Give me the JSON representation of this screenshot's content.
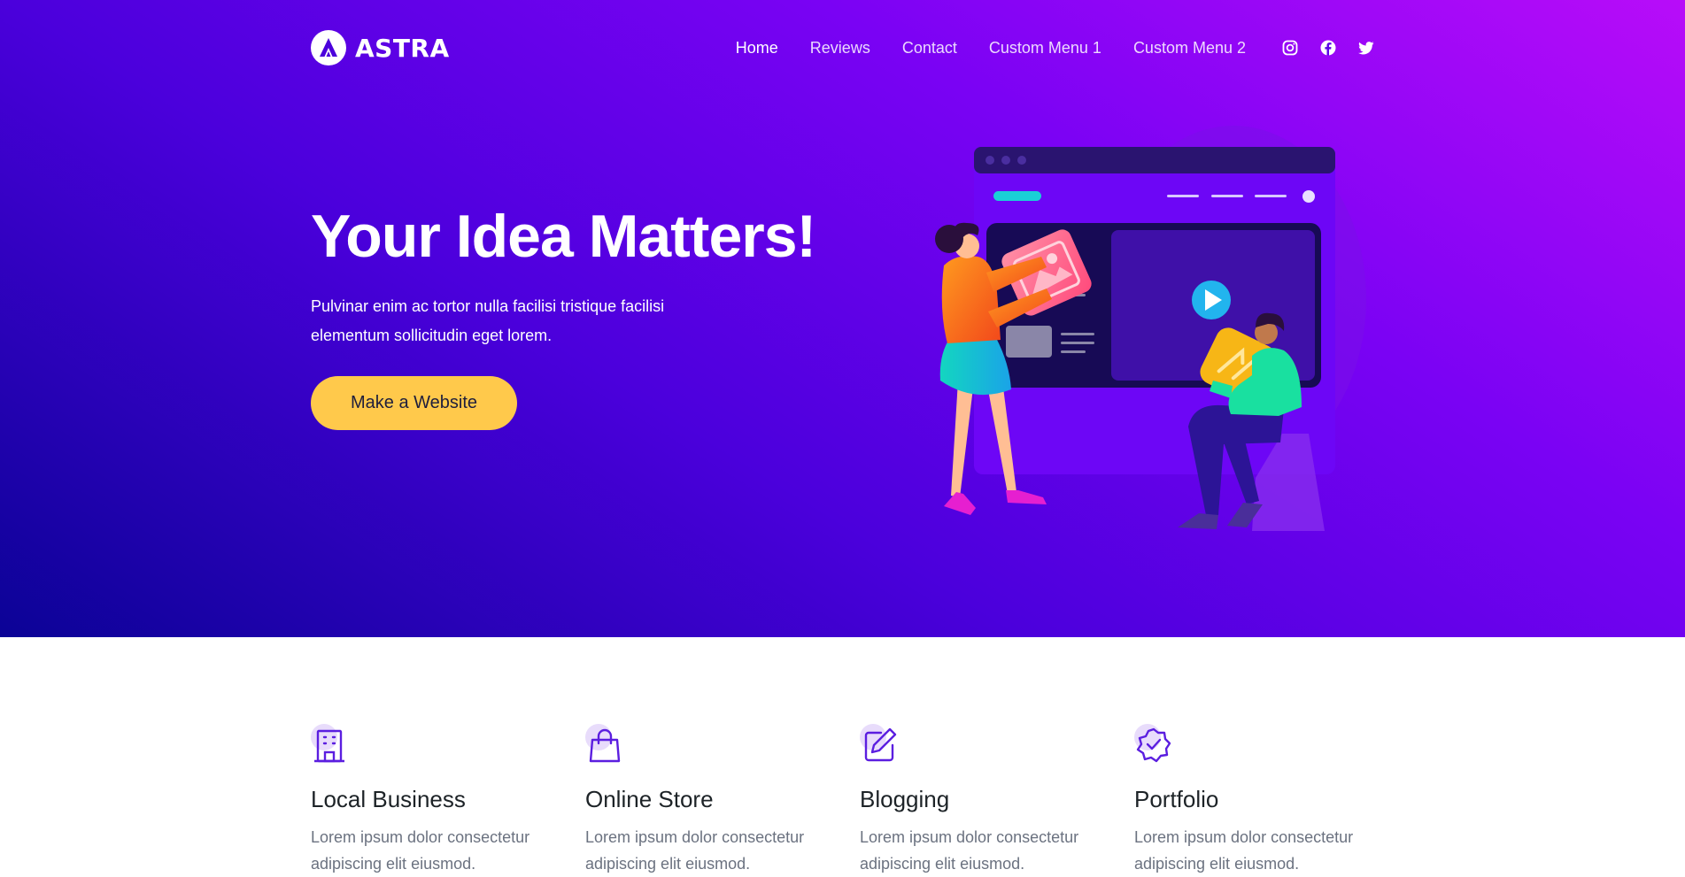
{
  "brand": {
    "name": "ASTRA"
  },
  "nav": {
    "items": [
      {
        "label": "Home",
        "active": true
      },
      {
        "label": "Reviews"
      },
      {
        "label": "Contact"
      },
      {
        "label": "Custom Menu 1"
      },
      {
        "label": "Custom Menu 2"
      }
    ],
    "social": [
      "instagram-icon",
      "facebook-icon",
      "twitter-icon"
    ]
  },
  "hero": {
    "title": "Your Idea Matters!",
    "text": "Pulvinar enim ac tortor nulla facilisi tristique facilisi elementum sollicitudin eget lorem.",
    "cta_label": "Make a Website"
  },
  "features": [
    {
      "icon": "building-icon",
      "title": "Local Business",
      "desc": "Lorem ipsum dolor consectetur adipiscing elit eiusmod."
    },
    {
      "icon": "shopping-bag-icon",
      "title": "Online Store",
      "desc": "Lorem ipsum dolor consectetur adipiscing elit eiusmod."
    },
    {
      "icon": "edit-icon",
      "title": "Blogging",
      "desc": "Lorem ipsum dolor consectetur adipiscing elit eiusmod."
    },
    {
      "icon": "badge-check-icon",
      "title": "Portfolio",
      "desc": "Lorem ipsum dolor consectetur adipiscing elit eiusmod."
    }
  ],
  "colors": {
    "gradient_start": "#0b0396",
    "gradient_end": "#b80cf9",
    "cta": "#ffc94b",
    "icon_stroke": "#5b1ee0",
    "icon_blob": "#e8dcfb"
  }
}
